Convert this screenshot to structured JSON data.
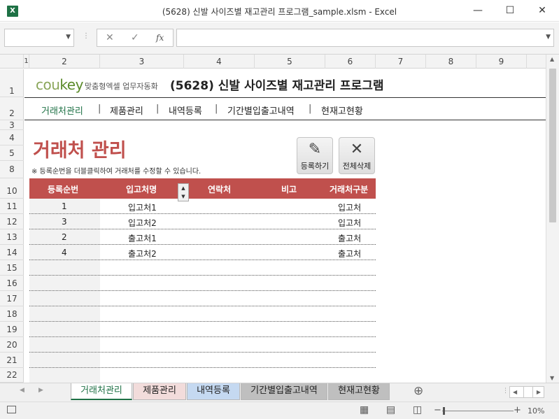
{
  "window": {
    "title": "(5628) 신발 사이즈별 재고관리 프로그램_sample.xlsm - Excel",
    "app_icon": "X",
    "buttons": {
      "minimize": "—",
      "maximize": "☐",
      "close": "✕"
    }
  },
  "formula_bar": {
    "name_box": "",
    "formula": "",
    "cancel": "✕",
    "enter": "✓",
    "fx": "fx"
  },
  "col_headers": [
    "1",
    "2",
    "3",
    "4",
    "5",
    "6",
    "7",
    "8",
    "9"
  ],
  "row_headers": [
    "1",
    "2",
    "3",
    "4",
    "5",
    "8",
    "10",
    "11",
    "12",
    "13",
    "14",
    "15",
    "16",
    "17",
    "18",
    "19",
    "20",
    "21",
    "22"
  ],
  "header": {
    "logo_cou": "cou",
    "logo_key": "key",
    "logo_sub": "맞춤형엑셀 업무자동화",
    "program_title": "(5628) 신발 사이즈별 재고관리 프로그램"
  },
  "nav": {
    "items": [
      "거래처관리",
      "제품관리",
      "내역등록",
      "기간별입출고내역",
      "현재고현황"
    ],
    "separator": "|"
  },
  "section": {
    "title": "거래처 관리",
    "hint": "※ 등록순번을 더블클릭하여 거래처를 수정할 수 있습니다."
  },
  "actions": {
    "register": {
      "label": "등록하기",
      "icon": "pencil-icon"
    },
    "delete_all": {
      "label": "전체삭제",
      "icon": "close-icon"
    }
  },
  "table": {
    "columns": [
      "등록순번",
      "입고처명",
      "연락처",
      "비고",
      "거래처구분"
    ],
    "rows": [
      {
        "no": "1",
        "name": "입고처1",
        "contact": "",
        "note": "",
        "type": "입고처"
      },
      {
        "no": "3",
        "name": "입고처2",
        "contact": "",
        "note": "",
        "type": "입고처"
      },
      {
        "no": "2",
        "name": "출고처1",
        "contact": "",
        "note": "",
        "type": "출고처"
      },
      {
        "no": "4",
        "name": "출고처2",
        "contact": "",
        "note": "",
        "type": "출고처"
      }
    ]
  },
  "sheet_tabs": [
    {
      "label": "거래처관리",
      "color": "#ffffff"
    },
    {
      "label": "제품관리",
      "color": "#f2dcdb"
    },
    {
      "label": "내역등록",
      "color": "#c5d9f1"
    },
    {
      "label": "기간별입출고내역",
      "color": "#bfbfbf"
    },
    {
      "label": "현재고현황",
      "color": "#bfbfbf"
    }
  ],
  "status": {
    "zoom": "10%",
    "minus": "−",
    "plus": "+"
  },
  "colors": {
    "accent": "#c0504d",
    "excel_green": "#1e7145",
    "logo_green": "#8aa65a"
  }
}
